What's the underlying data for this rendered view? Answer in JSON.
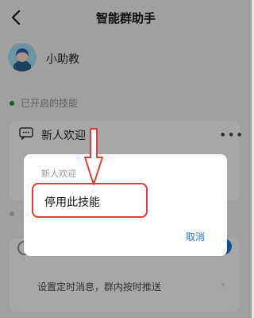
{
  "header": {
    "title": "智能群助手",
    "back_icon": "back-arrow-icon"
  },
  "profile": {
    "name": "小助教",
    "avatar_icon": "avatar-girl-icon"
  },
  "section": {
    "enabled_label": "已开启的技能"
  },
  "skill": {
    "title": "新人欢迎",
    "more_icon": "more-icon"
  },
  "timer_card": {
    "text": "设置定时消息，群内按时推送"
  },
  "dialog": {
    "title": "新人欢迎",
    "option_label": "停用此技能",
    "cancel_label": "取消"
  },
  "colors": {
    "accent_blue": "#1e6fd9",
    "highlight_red": "#e23b3b",
    "status_green": "#2e7d32"
  }
}
